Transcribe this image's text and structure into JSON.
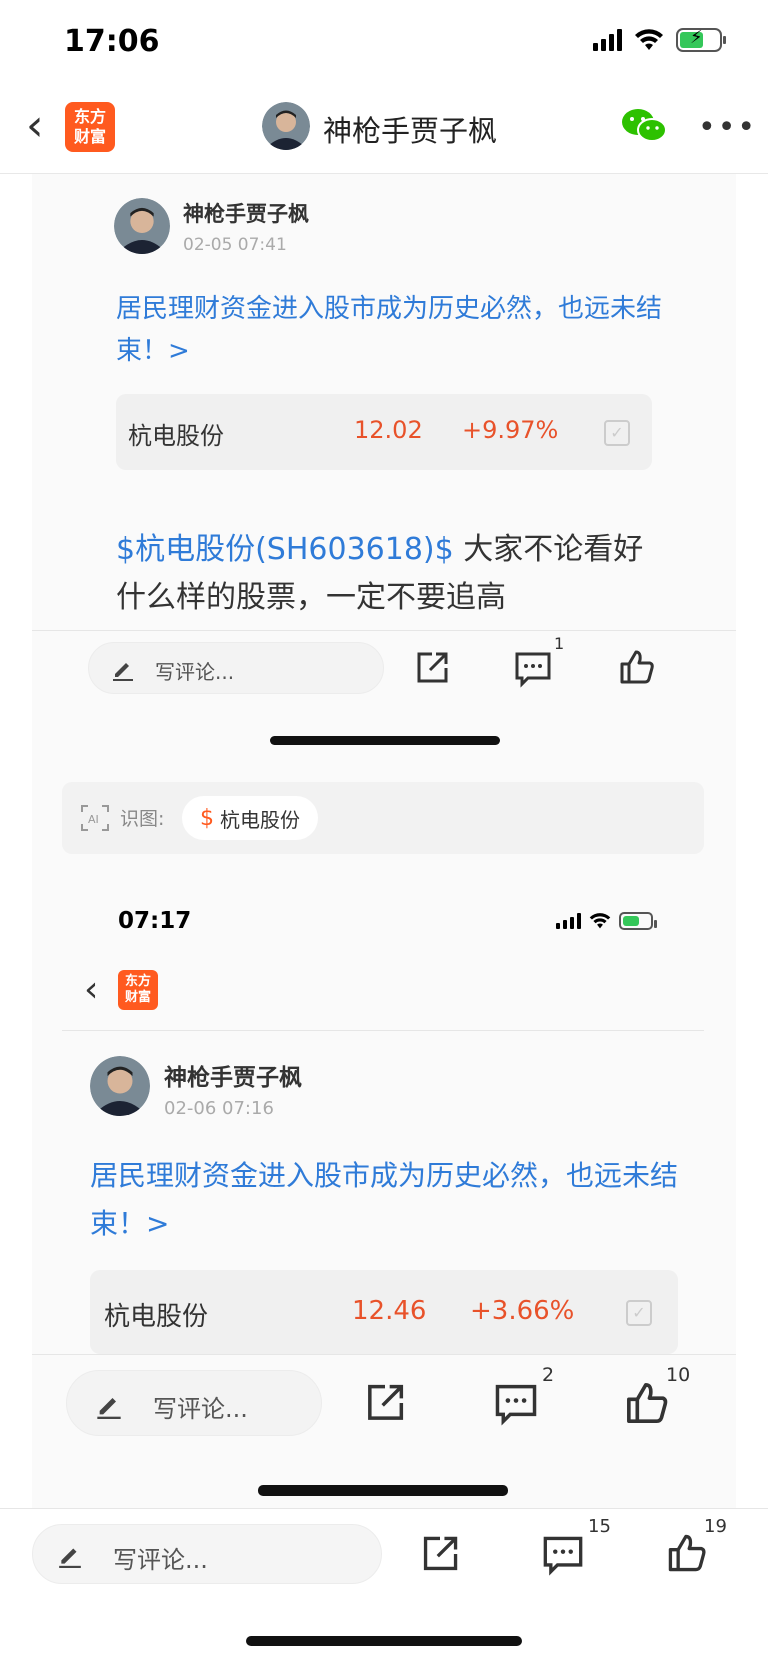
{
  "status_bar": {
    "time": "17:06"
  },
  "nav": {
    "title": "神枪手贾子枫",
    "logo_line1": "东方",
    "logo_line2": "财富",
    "back": "‹",
    "more": "•••"
  },
  "post1": {
    "author": "神枪手贾子枫",
    "date": "02-05 07:41",
    "headline": "居民理财资金进入股市成为历史必然，也远未结束！>",
    "stock": {
      "name": "杭电股份",
      "price": "12.02",
      "change": "+9.97%"
    },
    "body_tag": "$杭电股份(SH603618)$",
    "body_text": " 大家不论看好什么样的股票，一定不要追高",
    "comment_placeholder": "写评论...",
    "comment_count": "1"
  },
  "ocr": {
    "label": "识图:",
    "chip": "杭电股份",
    "chip_symbol": "$"
  },
  "inner_status": {
    "time": "07:17"
  },
  "post2": {
    "author": "神枪手贾子枫",
    "date": "02-06 07:16",
    "headline": "居民理财资金进入股市成为历史必然，也远未结束！>",
    "stock": {
      "name": "杭电股份",
      "price": "12.46",
      "change": "+3.66%"
    },
    "comment_placeholder": "写评论...",
    "comment_count": "2",
    "like_count": "10"
  },
  "bottom_bar": {
    "comment_placeholder": "写评论...",
    "comment_count": "15",
    "like_count": "19"
  },
  "colors": {
    "accent_blue": "#2f7bd8",
    "stock_red": "#e8522a",
    "brand_orange": "#ff5a1f"
  }
}
